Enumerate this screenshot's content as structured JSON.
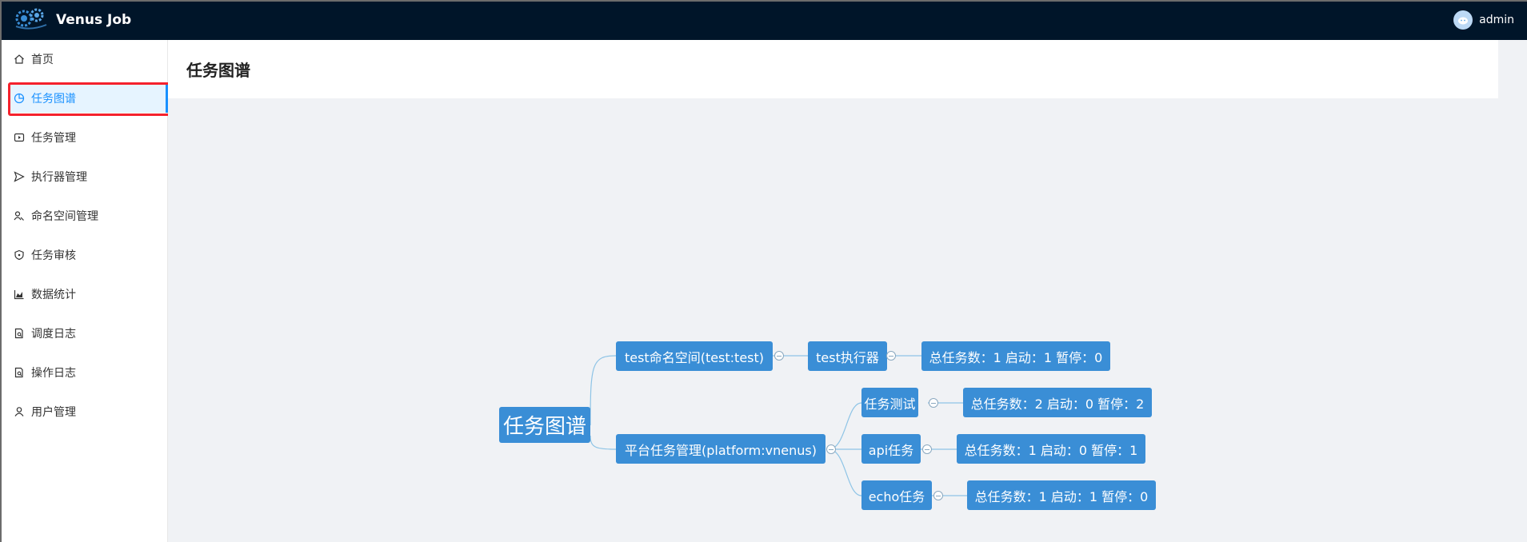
{
  "app": {
    "title": "Venus Job",
    "user": "admin"
  },
  "sidebar": {
    "items": [
      {
        "label": "首页",
        "icon": "home-icon"
      },
      {
        "label": "任务图谱",
        "icon": "pie-chart-icon",
        "active": true
      },
      {
        "label": "任务管理",
        "icon": "play-square-icon"
      },
      {
        "label": "执行器管理",
        "icon": "send-icon"
      },
      {
        "label": "命名空间管理",
        "icon": "users-icon"
      },
      {
        "label": "任务审核",
        "icon": "shield-icon"
      },
      {
        "label": "数据统计",
        "icon": "area-chart-icon"
      },
      {
        "label": "调度日志",
        "icon": "file-search-icon"
      },
      {
        "label": "操作日志",
        "icon": "file-search-icon"
      },
      {
        "label": "用户管理",
        "icon": "user-icon"
      }
    ]
  },
  "page": {
    "title": "任务图谱"
  },
  "graph": {
    "root": "任务图谱",
    "namespace1": "test命名空间(test:test)",
    "executor1": "test执行器",
    "executor1_stats": "总任务数：1 启动：1 暂停：0",
    "namespace2": "平台任务管理(platform:vnenus)",
    "task1": "任务测试",
    "task1_stats": "总任务数：2 启动：0 暂停：2",
    "task2": "api任务",
    "task2_stats": "总任务数：1 启动：0 暂停：1",
    "task3": "echo任务",
    "task3_stats": "总任务数：1 启动：1 暂停：0"
  },
  "colors": {
    "header_bg": "#001529",
    "accent": "#1890ff",
    "node": "#3a8ed6",
    "highlight": "#f5222d"
  }
}
